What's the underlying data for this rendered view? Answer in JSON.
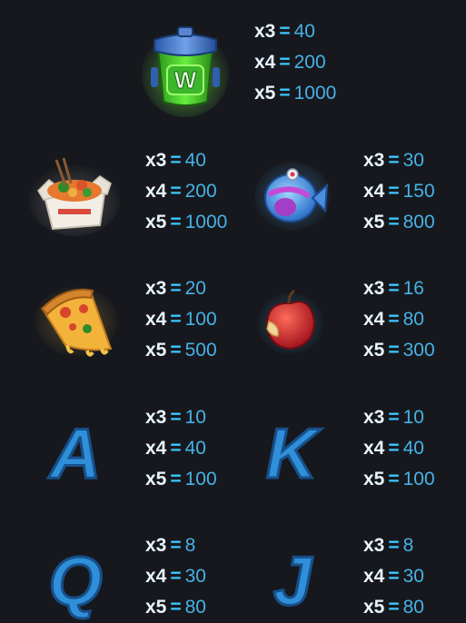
{
  "paytable": [
    {
      "symbol": "trash-can-wild",
      "label": "W",
      "pays": [
        {
          "mult": "x3",
          "eq": "=",
          "value": "40"
        },
        {
          "mult": "x4",
          "eq": "=",
          "value": "200"
        },
        {
          "mult": "x5",
          "eq": "=",
          "value": "1000"
        }
      ]
    },
    {
      "symbol": "noodle-box",
      "pays": [
        {
          "mult": "x3",
          "eq": "=",
          "value": "40"
        },
        {
          "mult": "x4",
          "eq": "=",
          "value": "200"
        },
        {
          "mult": "x5",
          "eq": "=",
          "value": "1000"
        }
      ]
    },
    {
      "symbol": "fish-bone",
      "pays": [
        {
          "mult": "x3",
          "eq": "=",
          "value": "30"
        },
        {
          "mult": "x4",
          "eq": "=",
          "value": "150"
        },
        {
          "mult": "x5",
          "eq": "=",
          "value": "800"
        }
      ]
    },
    {
      "symbol": "pizza-slice",
      "pays": [
        {
          "mult": "x3",
          "eq": "=",
          "value": "20"
        },
        {
          "mult": "x4",
          "eq": "=",
          "value": "100"
        },
        {
          "mult": "x5",
          "eq": "=",
          "value": "500"
        }
      ]
    },
    {
      "symbol": "bitten-apple",
      "pays": [
        {
          "mult": "x3",
          "eq": "=",
          "value": "16"
        },
        {
          "mult": "x4",
          "eq": "=",
          "value": "80"
        },
        {
          "mult": "x5",
          "eq": "=",
          "value": "300"
        }
      ]
    },
    {
      "symbol": "letter-a",
      "label": "A",
      "pays": [
        {
          "mult": "x3",
          "eq": "=",
          "value": "10"
        },
        {
          "mult": "x4",
          "eq": "=",
          "value": "40"
        },
        {
          "mult": "x5",
          "eq": "=",
          "value": "100"
        }
      ]
    },
    {
      "symbol": "letter-k",
      "label": "K",
      "pays": [
        {
          "mult": "x3",
          "eq": "=",
          "value": "10"
        },
        {
          "mult": "x4",
          "eq": "=",
          "value": "40"
        },
        {
          "mult": "x5",
          "eq": "=",
          "value": "100"
        }
      ]
    },
    {
      "symbol": "letter-q",
      "label": "Q",
      "pays": [
        {
          "mult": "x3",
          "eq": "=",
          "value": "8"
        },
        {
          "mult": "x4",
          "eq": "=",
          "value": "30"
        },
        {
          "mult": "x5",
          "eq": "=",
          "value": "80"
        }
      ]
    },
    {
      "symbol": "letter-j",
      "label": "J",
      "pays": [
        {
          "mult": "x3",
          "eq": "=",
          "value": "8"
        },
        {
          "mult": "x4",
          "eq": "=",
          "value": "30"
        },
        {
          "mult": "x5",
          "eq": "=",
          "value": "80"
        }
      ]
    }
  ],
  "colors": {
    "background": "#16181d",
    "multiplier": "#e8f4ff",
    "equals": "#3cc6ff",
    "value": "#46b2e6",
    "letter_blue": "#2f8fd8",
    "wild_green": "#4cd43a"
  }
}
